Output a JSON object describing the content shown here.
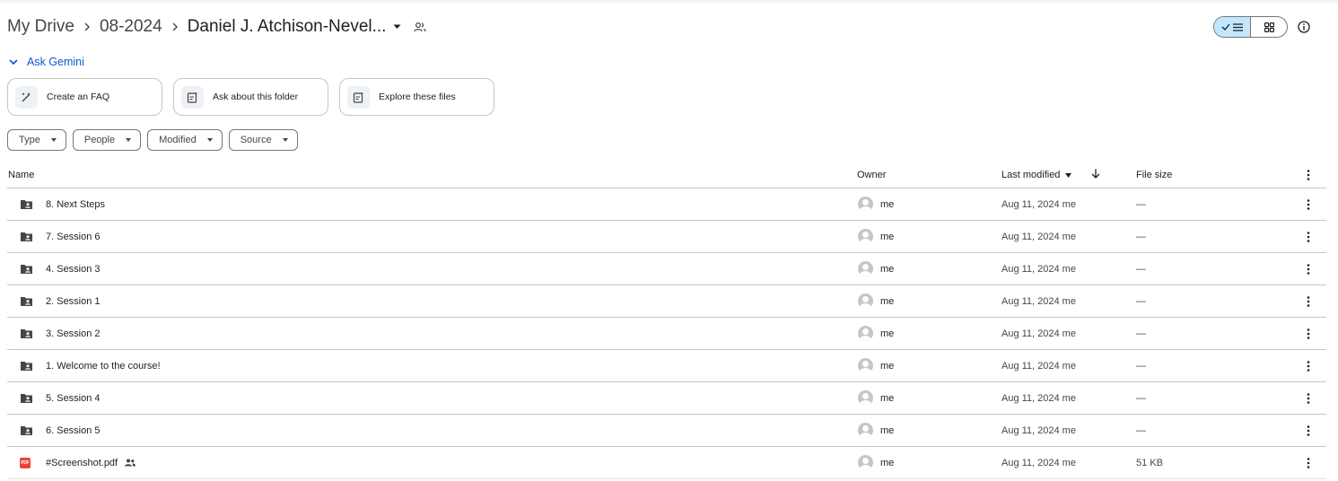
{
  "breadcrumb": {
    "root": "My Drive",
    "parent": "08-2024",
    "current": "Daniel J. Atchison-Nevel..."
  },
  "gemini": {
    "label": "Ask Gemini"
  },
  "chips": [
    {
      "label": "Create an FAQ",
      "icon": "magic-pen-icon"
    },
    {
      "label": "Ask about this folder",
      "icon": "folder-spark-icon"
    },
    {
      "label": "Explore these files",
      "icon": "files-spark-icon"
    }
  ],
  "filters": [
    {
      "label": "Type"
    },
    {
      "label": "People"
    },
    {
      "label": "Modified"
    },
    {
      "label": "Source"
    }
  ],
  "columns": {
    "name": "Name",
    "owner": "Owner",
    "modified": "Last modified",
    "size": "File size"
  },
  "files": [
    {
      "name": "8. Next Steps",
      "type": "shared-folder",
      "owner": "me",
      "modified": "Aug 11, 2024  me",
      "size": "—"
    },
    {
      "name": "7. Session 6",
      "type": "shared-folder",
      "owner": "me",
      "modified": "Aug 11, 2024  me",
      "size": "—"
    },
    {
      "name": "4. Session 3",
      "type": "shared-folder",
      "owner": "me",
      "modified": "Aug 11, 2024  me",
      "size": "—"
    },
    {
      "name": "2. Session 1",
      "type": "shared-folder",
      "owner": "me",
      "modified": "Aug 11, 2024  me",
      "size": "—"
    },
    {
      "name": "3. Session 2",
      "type": "shared-folder",
      "owner": "me",
      "modified": "Aug 11, 2024  me",
      "size": "—"
    },
    {
      "name": "1. Welcome to the course!",
      "type": "shared-folder",
      "owner": "me",
      "modified": "Aug 11, 2024  me",
      "size": "—"
    },
    {
      "name": "5. Session 4",
      "type": "shared-folder",
      "owner": "me",
      "modified": "Aug 11, 2024  me",
      "size": "—"
    },
    {
      "name": "6. Session 5",
      "type": "shared-folder",
      "owner": "me",
      "modified": "Aug 11, 2024  me",
      "size": "—"
    },
    {
      "name": "#Screenshot.pdf",
      "type": "pdf",
      "pdf_badge": "PDF",
      "shared": true,
      "owner": "me",
      "modified": "Aug 11, 2024  me",
      "size": "51 KB"
    }
  ],
  "colors": {
    "accent": "#0b57d0",
    "toggle_active": "#c2e7ff",
    "pdf_red": "#ea4335",
    "divider": "#c7c7c7"
  }
}
